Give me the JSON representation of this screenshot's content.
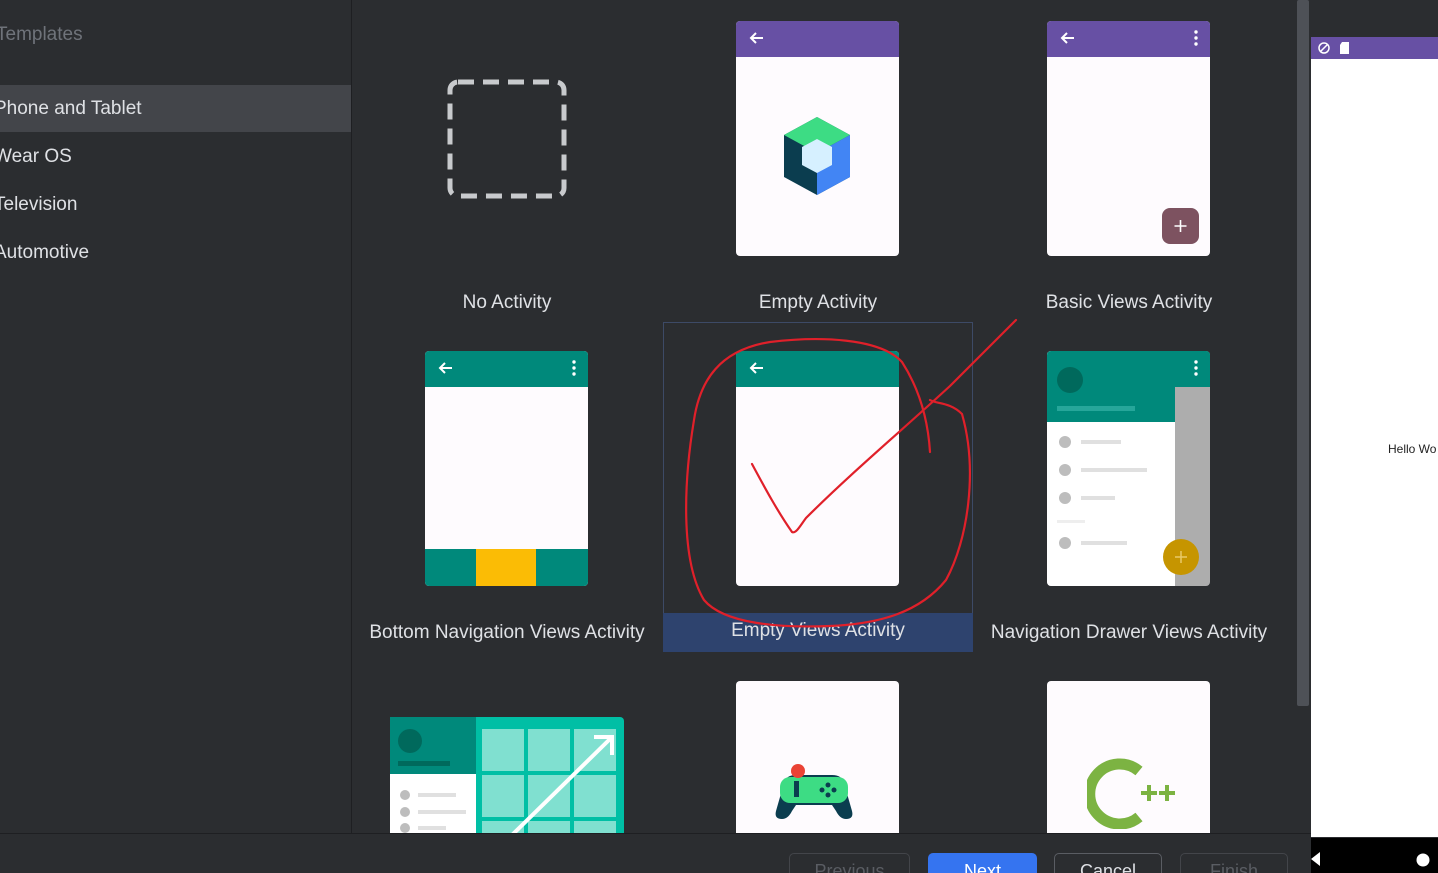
{
  "sidebar": {
    "title": "Templates",
    "items": [
      {
        "label": "Phone and Tablet",
        "selected": true
      },
      {
        "label": "Wear OS"
      },
      {
        "label": "Television"
      },
      {
        "label": "Automotive"
      }
    ]
  },
  "templates": [
    {
      "label": "No Activity"
    },
    {
      "label": "Empty Activity"
    },
    {
      "label": "Basic Views Activity"
    },
    {
      "label": "Bottom Navigation Views Activity"
    },
    {
      "label": "Empty Views Activity",
      "selected": true
    },
    {
      "label": "Navigation Drawer Views Activity"
    }
  ],
  "preview": {
    "hello_text": "Hello Wo"
  },
  "footer": {
    "previous_label": "Previous",
    "next_label": "Next",
    "cancel_label": "Cancel",
    "finish_label": "Finish"
  },
  "colors": {
    "purple_bar": "#6750a4",
    "teal_bar": "#00897b",
    "primary_button": "#3574f0",
    "selection": "#2e436e",
    "annotation": "#e0202a"
  }
}
